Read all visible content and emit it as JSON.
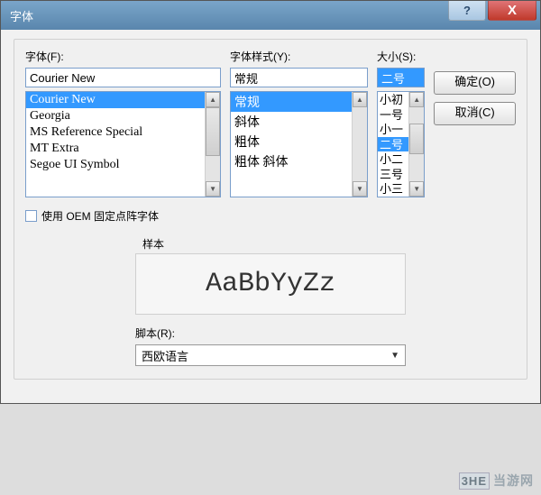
{
  "window": {
    "title": "字体"
  },
  "labels": {
    "font": "字体(F):",
    "style": "字体样式(Y):",
    "size": "大小(S):",
    "oem": "使用 OEM 固定点阵字体",
    "sample": "样本",
    "script": "脚本(R):"
  },
  "buttons": {
    "ok": "确定(O)",
    "cancel": "取消(C)",
    "help": "?",
    "close": "X"
  },
  "values": {
    "font": "Courier New",
    "style": "常规",
    "size": "二号",
    "sample": "AaBbYyZz",
    "script": "西欧语言"
  },
  "fontList": [
    "Courier New",
    "Georgia",
    "MS Reference Special",
    "MT Extra",
    "Segoe UI Symbol"
  ],
  "styleList": [
    "常规",
    "斜体",
    "粗体",
    "粗体 斜体"
  ],
  "sizeList": [
    "小初",
    "一号",
    "小一",
    "二号",
    "小二",
    "三号",
    "小三"
  ],
  "selected": {
    "fontIndex": 0,
    "styleIndex": 0,
    "sizeIndex": 3
  },
  "watermark": {
    "logo": "3HE",
    "text": "当游网"
  }
}
